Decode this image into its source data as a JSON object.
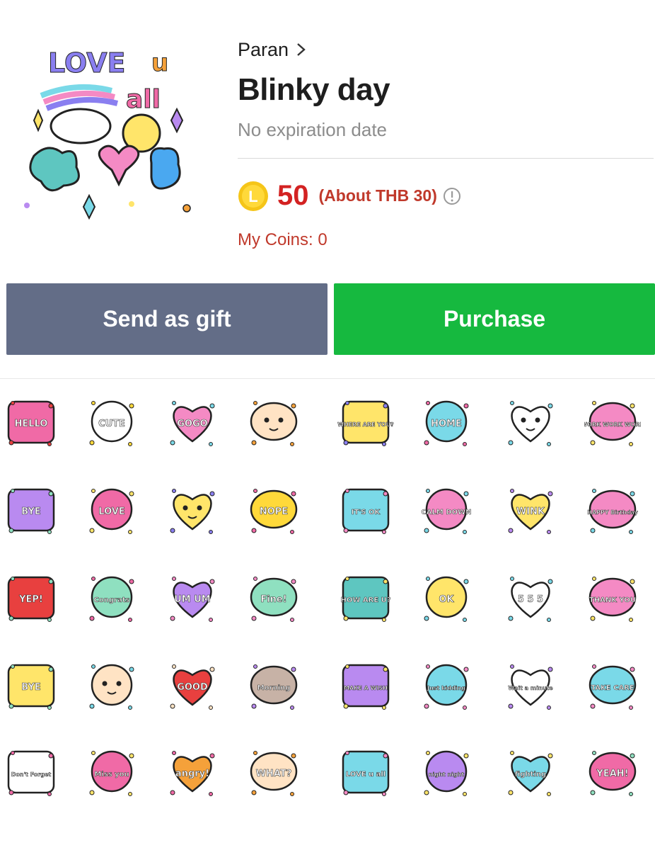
{
  "author": {
    "name": "Paran",
    "chevron_icon": "chevron-right-icon"
  },
  "pack": {
    "title": "Blinky day",
    "expiry": "No expiration date",
    "main_art_lettering": [
      "LOVE",
      "u",
      "all"
    ]
  },
  "price": {
    "coin_icon": "line-coin-icon",
    "coin_letter": "L",
    "coins": "50",
    "approx": "(About THB 30)",
    "info_icon": "info-circle-icon",
    "my_coins": "My Coins: 0"
  },
  "buttons": {
    "gift": "Send as gift",
    "purchase": "Purchase"
  },
  "colors": {
    "gift_button": "#636d87",
    "purchase_button": "#16b93f",
    "price_red": "#d32222",
    "coin_gold": "#f5c518"
  },
  "stickers": [
    {
      "name": "sticker-hello",
      "text": "HELLO",
      "bg": "#f06aa6",
      "accent": "#e8403f"
    },
    {
      "name": "sticker-cute",
      "text": "CUTE",
      "bg": "#ffffff",
      "accent": "#ffd93a"
    },
    {
      "name": "sticker-gogo",
      "text": "GOGO",
      "bg": "#f48ac4",
      "accent": "#7ad9e8"
    },
    {
      "name": "sticker-face",
      "text": "",
      "bg": "#ffe3c4",
      "accent": "#f5a13a"
    },
    {
      "name": "sticker-where-are-you",
      "text": "WHERE ARE YOU?",
      "bg": "#ffe56a",
      "accent": "#8a7ff0"
    },
    {
      "name": "sticker-home",
      "text": "HOME",
      "bg": "#7ad9e8",
      "accent": "#f06aa6"
    },
    {
      "name": "sticker-frame",
      "text": "",
      "bg": "#ffffff",
      "accent": "#7ad9e8"
    },
    {
      "name": "sticker-work",
      "text": "WORK WORK WORK",
      "bg": "#f48ac4",
      "accent": "#ffe56a"
    },
    {
      "name": "sticker-bye",
      "text": "BYE",
      "bg": "#b98af0",
      "accent": "#8fe0c0"
    },
    {
      "name": "sticker-love",
      "text": "LOVE",
      "bg": "#f06aa6",
      "accent": "#ffe56a"
    },
    {
      "name": "sticker-burst",
      "text": "",
      "bg": "#ffe56a",
      "accent": "#8a7ff0"
    },
    {
      "name": "sticker-nope",
      "text": "NOPE",
      "bg": "#ffd93a",
      "accent": "#f06aa6"
    },
    {
      "name": "sticker-its-ok",
      "text": "IT'S OK",
      "bg": "#7ad9e8",
      "accent": "#f48ac4"
    },
    {
      "name": "sticker-calm-down",
      "text": "CALM DOWN",
      "bg": "#f48ac4",
      "accent": "#7ad9e8"
    },
    {
      "name": "sticker-wink",
      "text": "WINK",
      "bg": "#ffe56a",
      "accent": "#b98af0"
    },
    {
      "name": "sticker-happy-birthday",
      "text": "HAPPY Birthday",
      "bg": "#f48ac4",
      "accent": "#7ad9e8"
    },
    {
      "name": "sticker-yep",
      "text": "YEP!",
      "bg": "#e8403f",
      "accent": "#8fe0c0"
    },
    {
      "name": "sticker-congrats",
      "text": "Congrats",
      "bg": "#8fe0c0",
      "accent": "#f06aa6"
    },
    {
      "name": "sticker-um-um",
      "text": "UM UM",
      "bg": "#b98af0",
      "accent": "#f48ac4"
    },
    {
      "name": "sticker-fine",
      "text": "Fine!",
      "bg": "#8fe0c0",
      "accent": "#f48ac4"
    },
    {
      "name": "sticker-how-are-u",
      "text": "HOW ARE U?",
      "bg": "#5ec6c0",
      "accent": "#ffe56a"
    },
    {
      "name": "sticker-ok",
      "text": "OK",
      "bg": "#ffe56a",
      "accent": "#7ad9e8"
    },
    {
      "name": "sticker-555",
      "text": "5 5 5",
      "bg": "#ffffff",
      "accent": "#7ad9e8"
    },
    {
      "name": "sticker-thank-you",
      "text": "THANK YOU",
      "bg": "#f48ac4",
      "accent": "#ffe56a"
    },
    {
      "name": "sticker-bye-flower",
      "text": "BYE",
      "bg": "#ffe56a",
      "accent": "#8fe0c0"
    },
    {
      "name": "sticker-crying",
      "text": "",
      "bg": "#ffe3c4",
      "accent": "#7ad9e8"
    },
    {
      "name": "sticker-good",
      "text": "GOOD",
      "bg": "#e8403f",
      "accent": "#ffe3c4"
    },
    {
      "name": "sticker-morning",
      "text": "Morning",
      "bg": "#c7b2a6",
      "accent": "#b98af0"
    },
    {
      "name": "sticker-make-a-wish",
      "text": "MAKE A WISH",
      "bg": "#b98af0",
      "accent": "#ffe56a"
    },
    {
      "name": "sticker-just-kidding",
      "text": "Just kidding",
      "bg": "#7ad9e8",
      "accent": "#f48ac4"
    },
    {
      "name": "sticker-wait-a-minute",
      "text": "Wait a minute",
      "bg": "#ffffff",
      "accent": "#b98af0"
    },
    {
      "name": "sticker-take-care",
      "text": "TAKE CARE",
      "bg": "#7ad9e8",
      "accent": "#f48ac4"
    },
    {
      "name": "sticker-dont-forget",
      "text": "Don't Forget",
      "bg": "#ffffff",
      "accent": "#f06aa6"
    },
    {
      "name": "sticker-miss-you",
      "text": "Miss you",
      "bg": "#f06aa6",
      "accent": "#ffe56a"
    },
    {
      "name": "sticker-angry",
      "text": "angry!",
      "bg": "#f5a13a",
      "accent": "#f06aa6"
    },
    {
      "name": "sticker-what",
      "text": "WHAT?",
      "bg": "#ffe3c4",
      "accent": "#f5a13a"
    },
    {
      "name": "sticker-love-u-all",
      "text": "LOVE u all",
      "bg": "#7ad9e8",
      "accent": "#f48ac4"
    },
    {
      "name": "sticker-night-night",
      "text": "night night",
      "bg": "#b98af0",
      "accent": "#ffe56a"
    },
    {
      "name": "sticker-fighting",
      "text": "fighting",
      "bg": "#7ad9e8",
      "accent": "#ffe56a"
    },
    {
      "name": "sticker-yeah",
      "text": "YEAH!",
      "bg": "#f06aa6",
      "accent": "#8fe0c0"
    }
  ]
}
